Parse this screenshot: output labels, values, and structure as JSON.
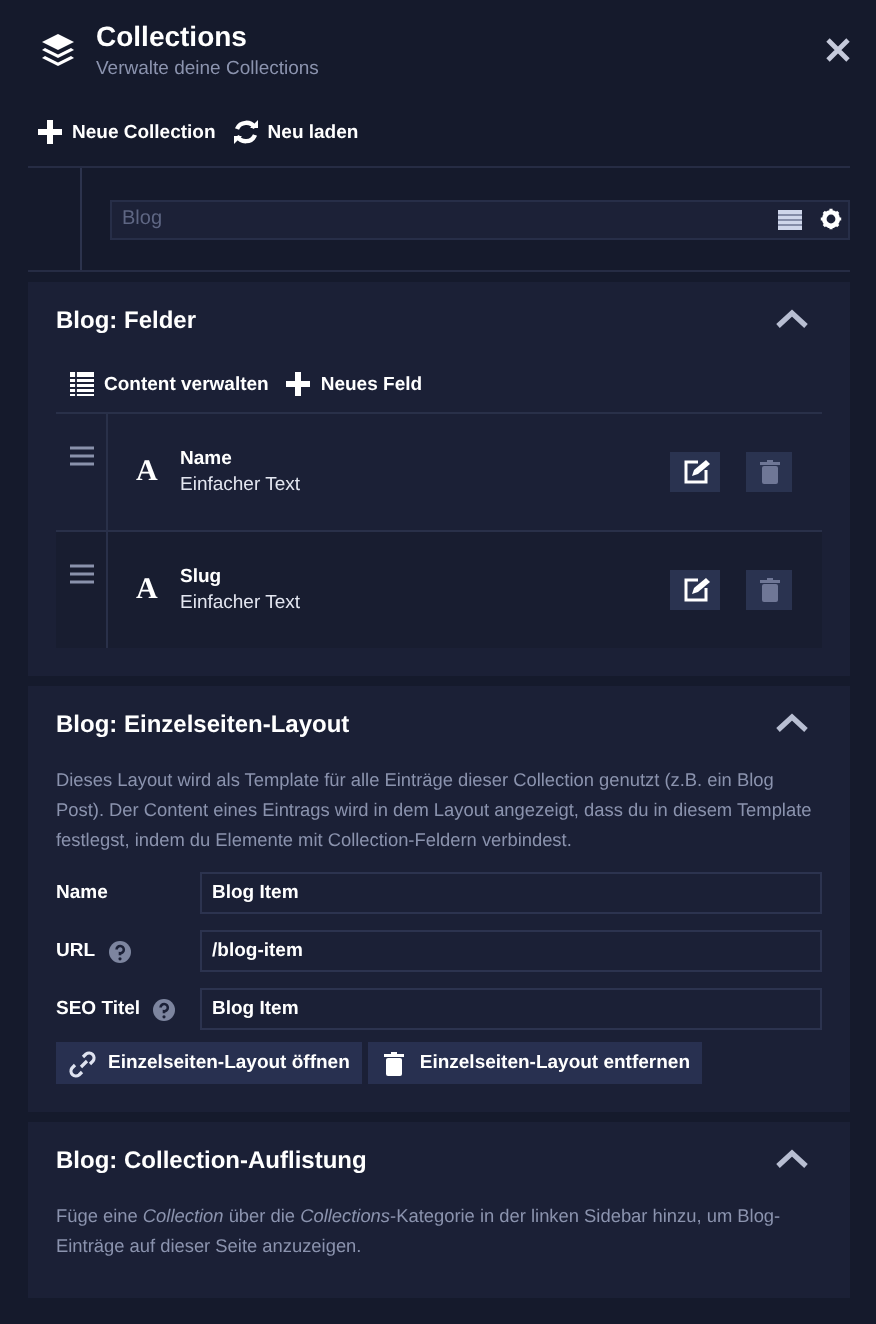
{
  "header": {
    "title": "Collections",
    "subtitle": "Verwalte deine Collections"
  },
  "toolbar": [
    {
      "kind": "add",
      "label": "Neue Collection"
    },
    {
      "kind": "reload",
      "label": "Neu laden"
    }
  ],
  "collection_field": {
    "value": "Blog"
  },
  "sections": [
    {
      "kind": "fields",
      "title": "Blog: Felder",
      "expanded": true,
      "actions": [
        {
          "kind": "content",
          "label": "Content verwalten"
        },
        {
          "kind": "add",
          "label": "Neues Feld"
        }
      ],
      "fields": [
        {
          "glyph": "A",
          "name": "Name",
          "type": "Einfacher Text"
        },
        {
          "glyph": "A",
          "name": "Slug",
          "type": "Einfacher Text"
        }
      ]
    },
    {
      "kind": "layout",
      "title": "Blog: Einzelseiten-Layout",
      "expanded": true,
      "description": "Dieses Layout wird als Template für alle Einträge dieser Collection genutzt (z.B. ein Blog Post). Der Content eines Eintrags wird in dem Layout angezeigt, dass du in diesem Template festlegst, indem du Elemente mit Collection-Feldern verbindest.",
      "form": [
        {
          "label": "Name",
          "help": false,
          "value": "Blog Item"
        },
        {
          "label": "URL",
          "help": true,
          "value": "/blog-item"
        },
        {
          "label": "SEO Titel",
          "help": true,
          "value": "Blog Item"
        }
      ],
      "buttons": [
        {
          "kind": "open",
          "label": "Einzelseiten-Layout öffnen"
        },
        {
          "kind": "remove",
          "label": "Einzelseiten-Layout entfernen"
        }
      ]
    },
    {
      "kind": "listing",
      "title": "Blog: Collection-Auflistung",
      "expanded": true,
      "description": "Füge eine *Collection* über die *Collections*-Kategorie in der linken Sidebar hinzu, um Blog-Einträge auf dieser Seite anzuzeigen."
    }
  ]
}
